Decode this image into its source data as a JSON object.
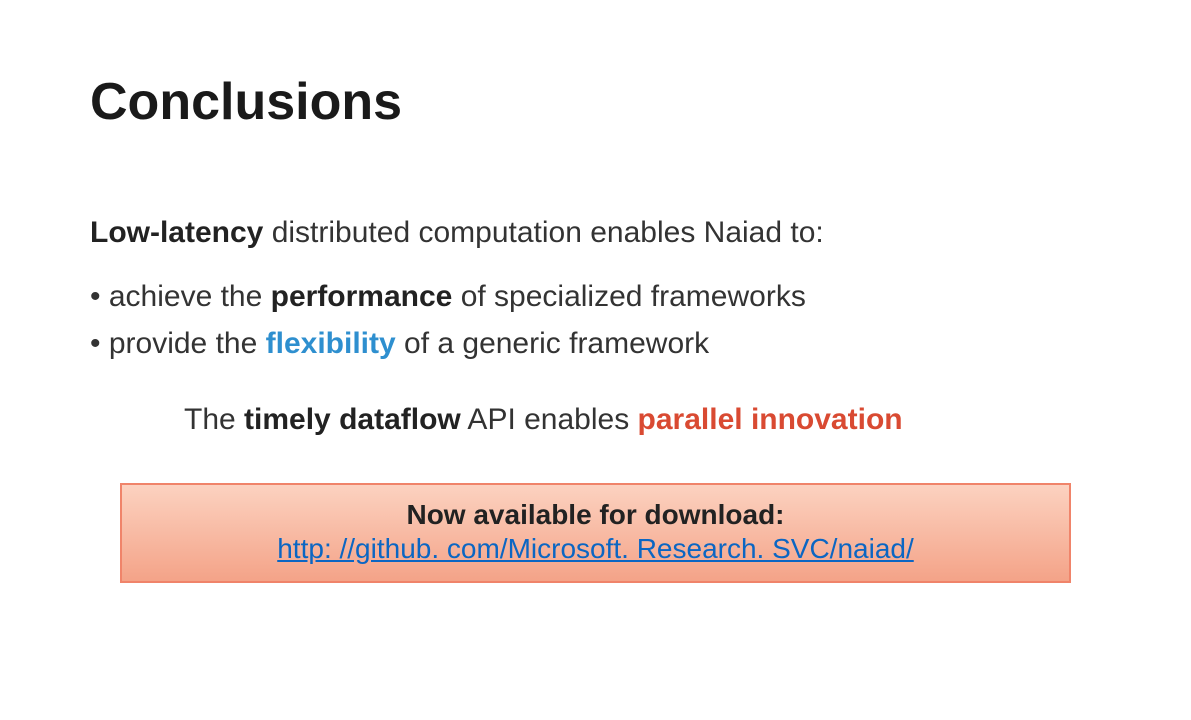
{
  "title": "Conclusions",
  "intro": {
    "bold": "Low-latency",
    "rest": " distributed computation enables Naiad to:"
  },
  "bullets": [
    {
      "pre": "achieve the ",
      "strong": "performance",
      "post": " of specialized frameworks"
    },
    {
      "pre": "provide the ",
      "accent": "flexibility",
      "post": " of a generic framework"
    }
  ],
  "statement": {
    "pre": "The ",
    "bold": "timely dataflow",
    "mid": " API enables ",
    "accent": "parallel innovation"
  },
  "download": {
    "label": "Now available for download:",
    "url_text": "http: //github. com/Microsoft. Research. SVC/naiad/",
    "url_href": "http://github.com/MicrosoftResearchSVC/naiad/"
  }
}
